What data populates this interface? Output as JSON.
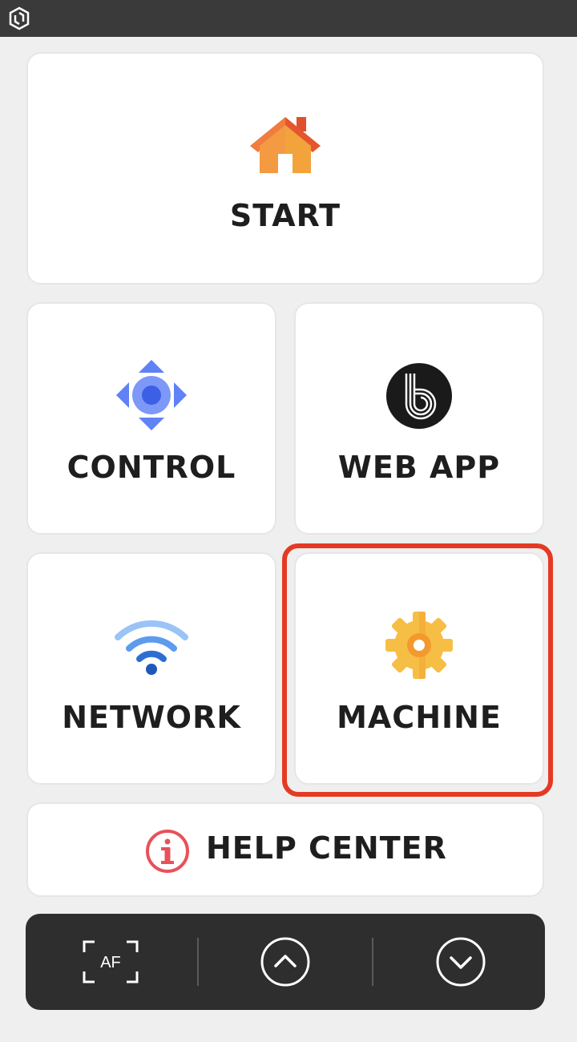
{
  "topbar": {
    "logo_icon": "app-logo-icon"
  },
  "tiles": {
    "start": {
      "label": "START",
      "icon": "home-icon"
    },
    "control": {
      "label": "CONTROL",
      "icon": "directional-pad-icon"
    },
    "webapp": {
      "label": "WEB APP",
      "icon": "b-logo-icon"
    },
    "network": {
      "label": "NETWORK",
      "icon": "wifi-icon"
    },
    "machine": {
      "label": "MACHINE",
      "icon": "gear-icon",
      "highlighted": true
    }
  },
  "help": {
    "label": "HELP CENTER",
    "icon": "info-icon"
  },
  "bottombar": {
    "af_label": "AF",
    "buttons": [
      "autofocus-button",
      "scroll-up-button",
      "scroll-down-button"
    ]
  },
  "colors": {
    "highlight": "#e43a24",
    "control_icon": "#4f6ff0",
    "network_icon": "#2f6fd6",
    "machine_icon": "#f6b23c",
    "help_icon": "#e8515a",
    "home_roof": "#ef6a3a",
    "home_body": "#f5a23a"
  }
}
